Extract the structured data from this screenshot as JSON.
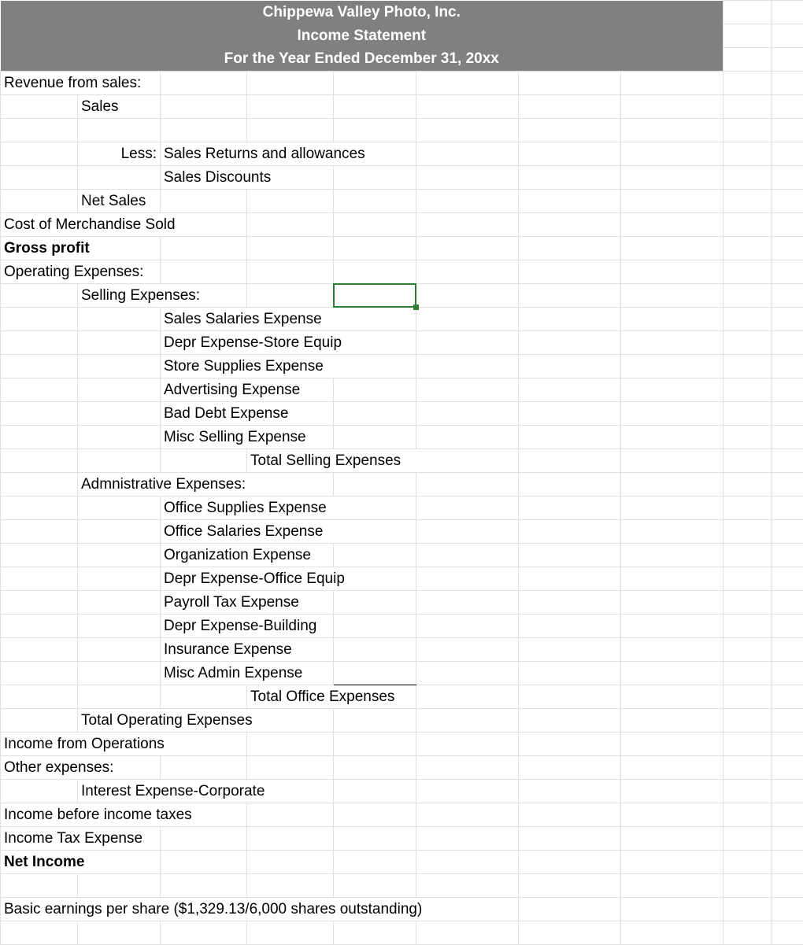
{
  "header": {
    "company": "Chippewa Valley Photo, Inc.",
    "title": "Income Statement",
    "period": "For the Year Ended December 31, 20xx"
  },
  "rows": {
    "revenue_from_sales": "Revenue from sales:",
    "sales": "Sales",
    "less": "Less:",
    "sales_returns": "Sales Returns and allowances",
    "sales_discounts": "Sales Discounts",
    "net_sales": "Net Sales",
    "cogs": "Cost of Merchandise Sold",
    "gross_profit": "Gross profit",
    "operating_expenses": "Operating Expenses:",
    "selling_expenses": "Selling Expenses:",
    "sales_salaries": "Sales Salaries Expense",
    "depr_store": "Depr Expense-Store Equip",
    "store_supplies": "Store Supplies Expense",
    "advertising": "Advertising Expense",
    "bad_debt": "Bad Debt Expense",
    "misc_selling": "Misc Selling Expense",
    "total_selling": "Total Selling Expenses",
    "admin_expenses": "Admnistrative Expenses:",
    "office_supplies": "Office Supplies Expense",
    "office_salaries": "Office Salaries Expense",
    "organization": "Organization Expense",
    "depr_office": "Depr Expense-Office Equip",
    "payroll_tax": "Payroll Tax Expense",
    "depr_building": "Depr Expense-Building",
    "insurance": "Insurance Expense",
    "misc_admin": "Misc Admin Expense",
    "total_office": "Total Office Expenses",
    "total_operating": "Total Operating Expenses",
    "income_operations": "Income from Operations",
    "other_expenses": "Other expenses:",
    "interest_expense": "Interest Expense-Corporate",
    "income_before_tax": "Income before income taxes",
    "income_tax": "Income Tax Expense",
    "net_income": "Net Income",
    "eps": "Basic earnings per share ($1,329.13/6,000 shares outstanding)"
  }
}
